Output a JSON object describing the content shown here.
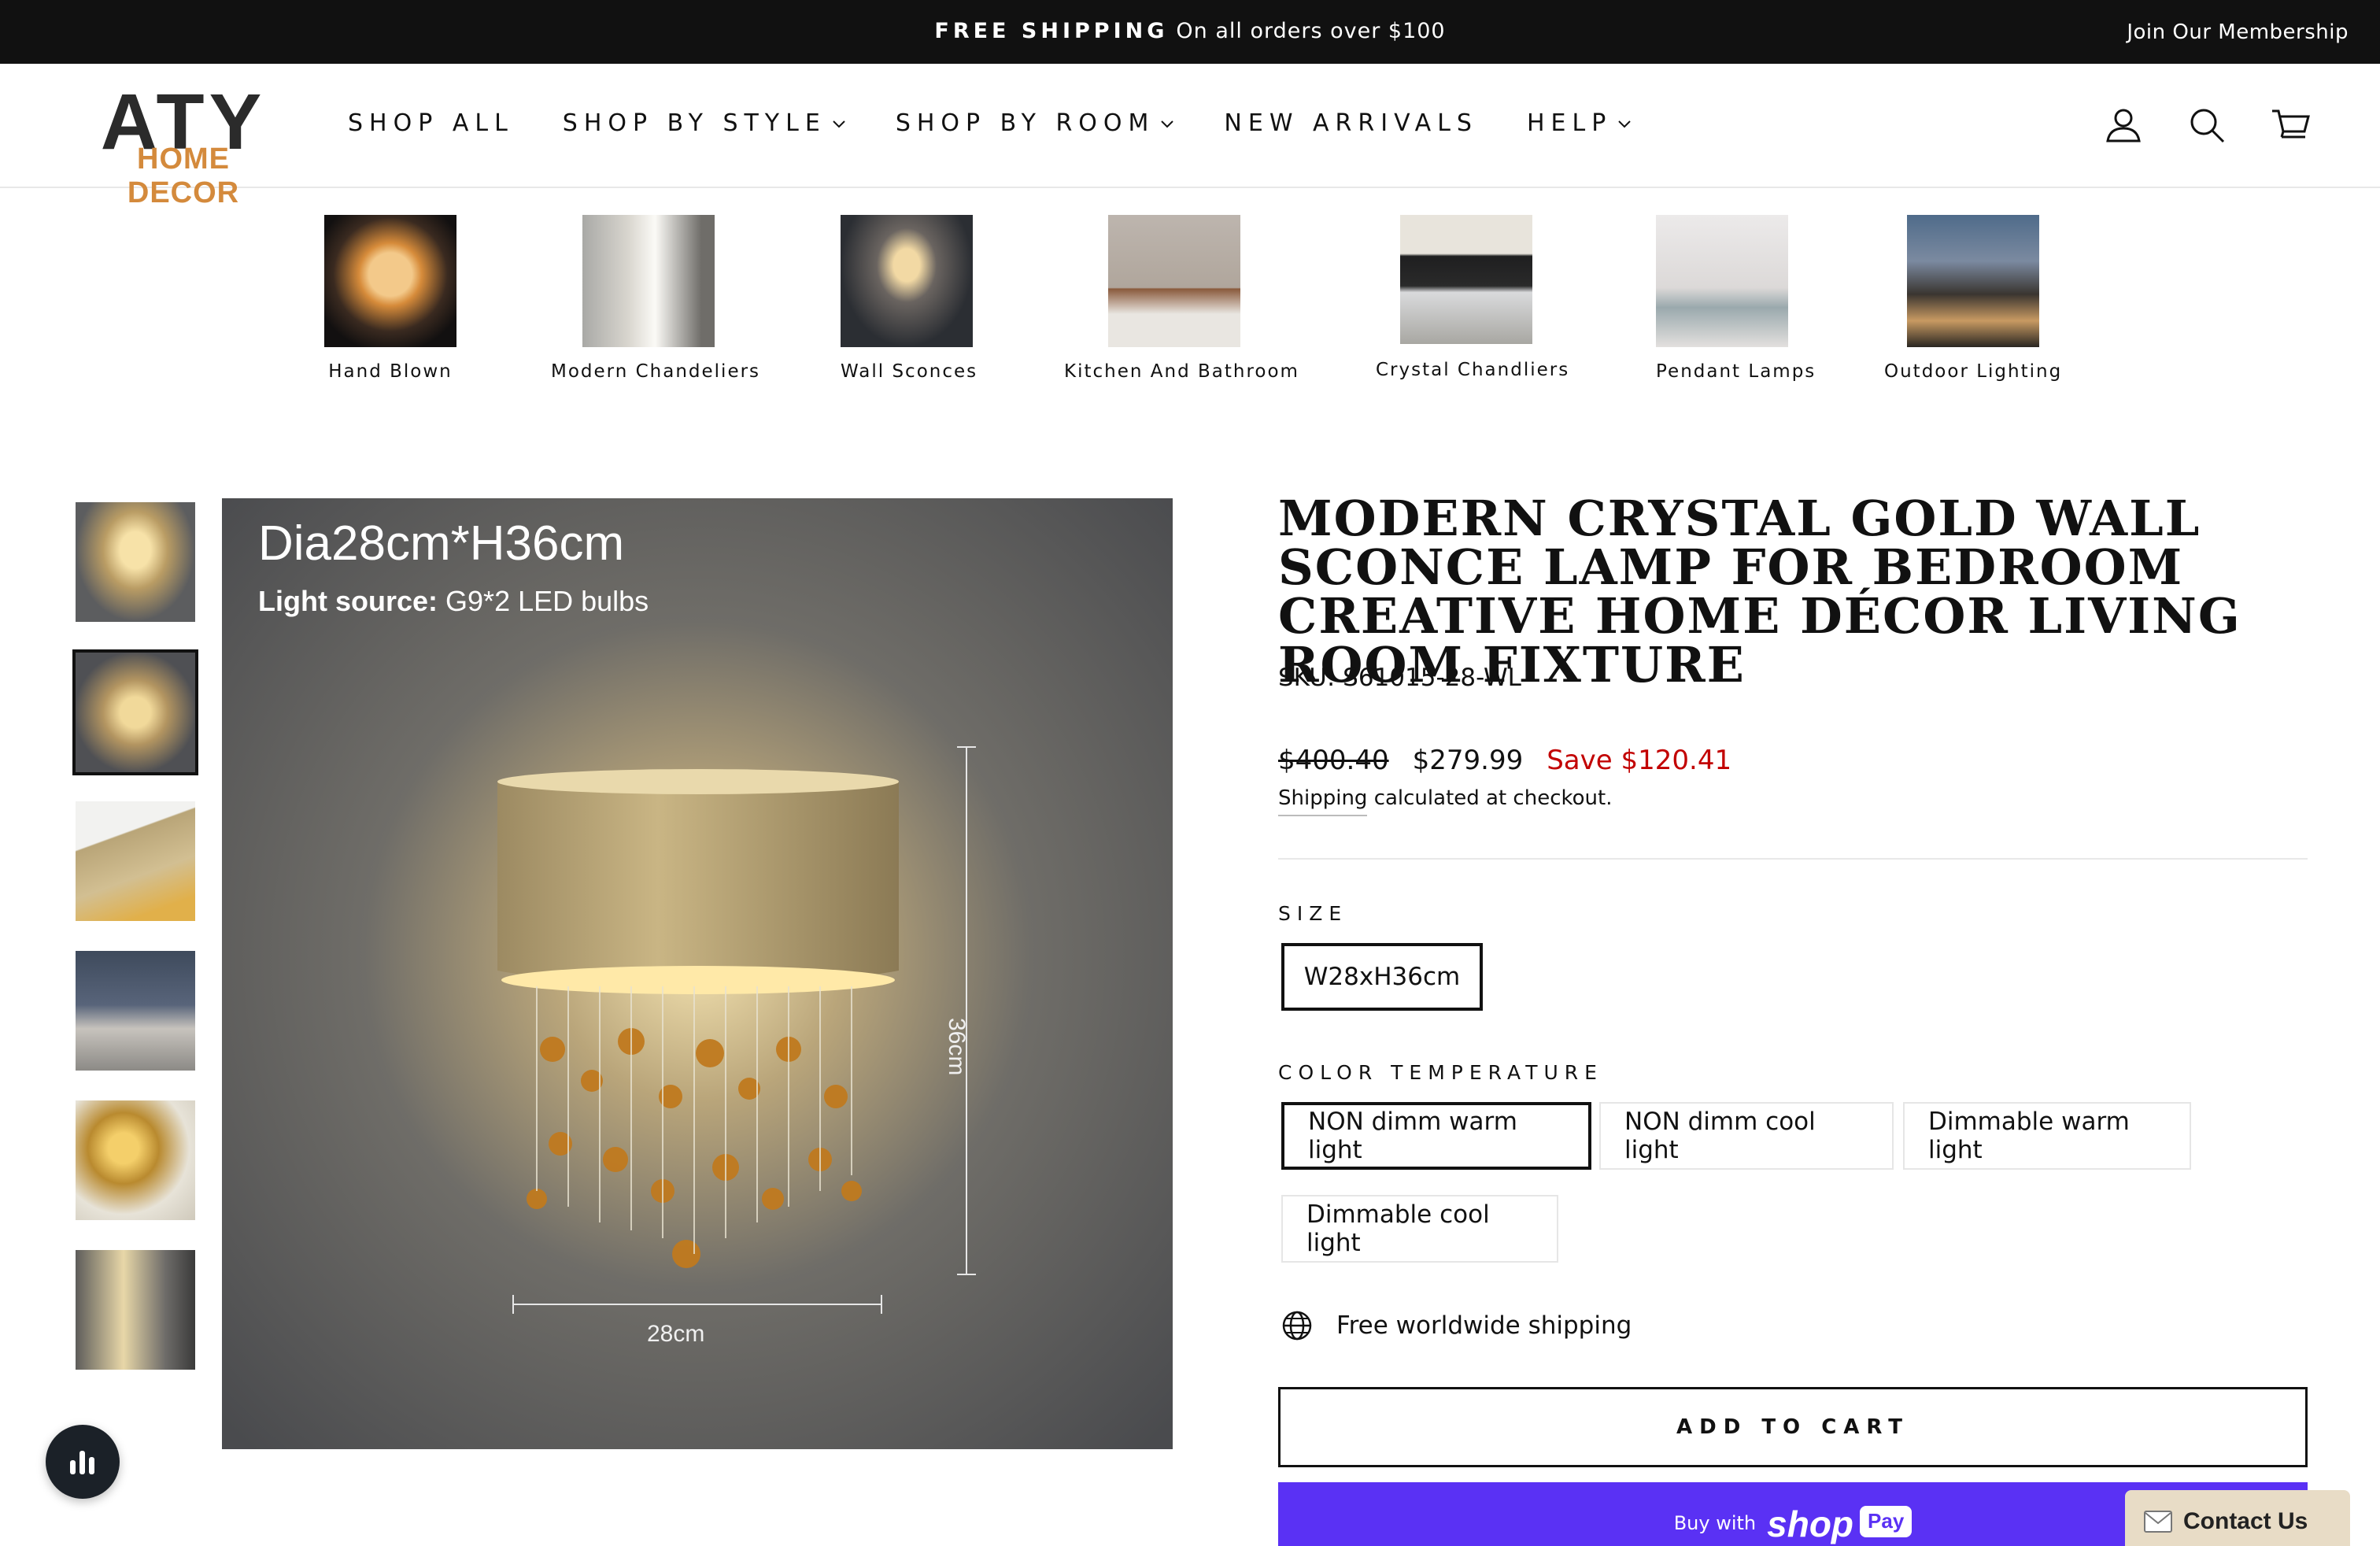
{
  "announcement": {
    "bold": "FREE SHIPPING",
    "text": "On all orders over $100",
    "membership": "Join Our Membership"
  },
  "header": {
    "logo_main": "ATY",
    "logo_sub": "HOME DECOR",
    "nav": [
      {
        "label": "SHOP ALL",
        "dropdown": false
      },
      {
        "label": "SHOP BY STYLE",
        "dropdown": true
      },
      {
        "label": "SHOP BY ROOM",
        "dropdown": true
      },
      {
        "label": "NEW ARRIVALS",
        "dropdown": false
      },
      {
        "label": "HELP",
        "dropdown": true
      }
    ],
    "icons": [
      "account-icon",
      "search-icon",
      "cart-icon"
    ]
  },
  "categories": [
    {
      "label": "Hand Blown"
    },
    {
      "label": "Modern Chandeliers"
    },
    {
      "label": "Wall Sconces"
    },
    {
      "label": "Kitchen And Bathroom"
    },
    {
      "label": "Crystal Chandliers"
    },
    {
      "label": "Pendant Lamps"
    },
    {
      "label": "Outdoor Lighting"
    }
  ],
  "gallery": {
    "selected_index": 1,
    "main_image_text": {
      "dimension": "Dia28cm*H36cm",
      "light_source_label": "Light source:",
      "light_source_value": "G9*2 LED bulbs",
      "height_label": "36cm",
      "width_label": "28cm"
    }
  },
  "product": {
    "title": "MODERN CRYSTAL GOLD WALL SCONCE LAMP FOR BEDROOM CREATIVE HOME DÉCOR LIVING ROOM FIXTURE",
    "sku": "SKU: S61015-28-WL",
    "price_old": "$400.40",
    "price_new": "$279.99",
    "save": "Save $120.41",
    "shipping_link": "Shipping",
    "shipping_text": "calculated at checkout.",
    "size_label": "SIZE",
    "sizes": [
      "W28xH36cm"
    ],
    "color_label": "COLOR TEMPERATURE",
    "colors": [
      "NON dimm warm light",
      "NON dimm cool light",
      "Dimmable warm light",
      "Dimmable cool light"
    ],
    "feature": "Free worldwide shipping",
    "add_to_cart": "ADD TO CART",
    "buy_with": "Buy with",
    "shop": "shop",
    "pay": "Pay"
  },
  "widgets": {
    "contact": "Contact Us"
  },
  "colors": {
    "accent_sale": "#c20000",
    "shop_pay": "#5a31f4",
    "logo_orange": "#d48a3c"
  }
}
